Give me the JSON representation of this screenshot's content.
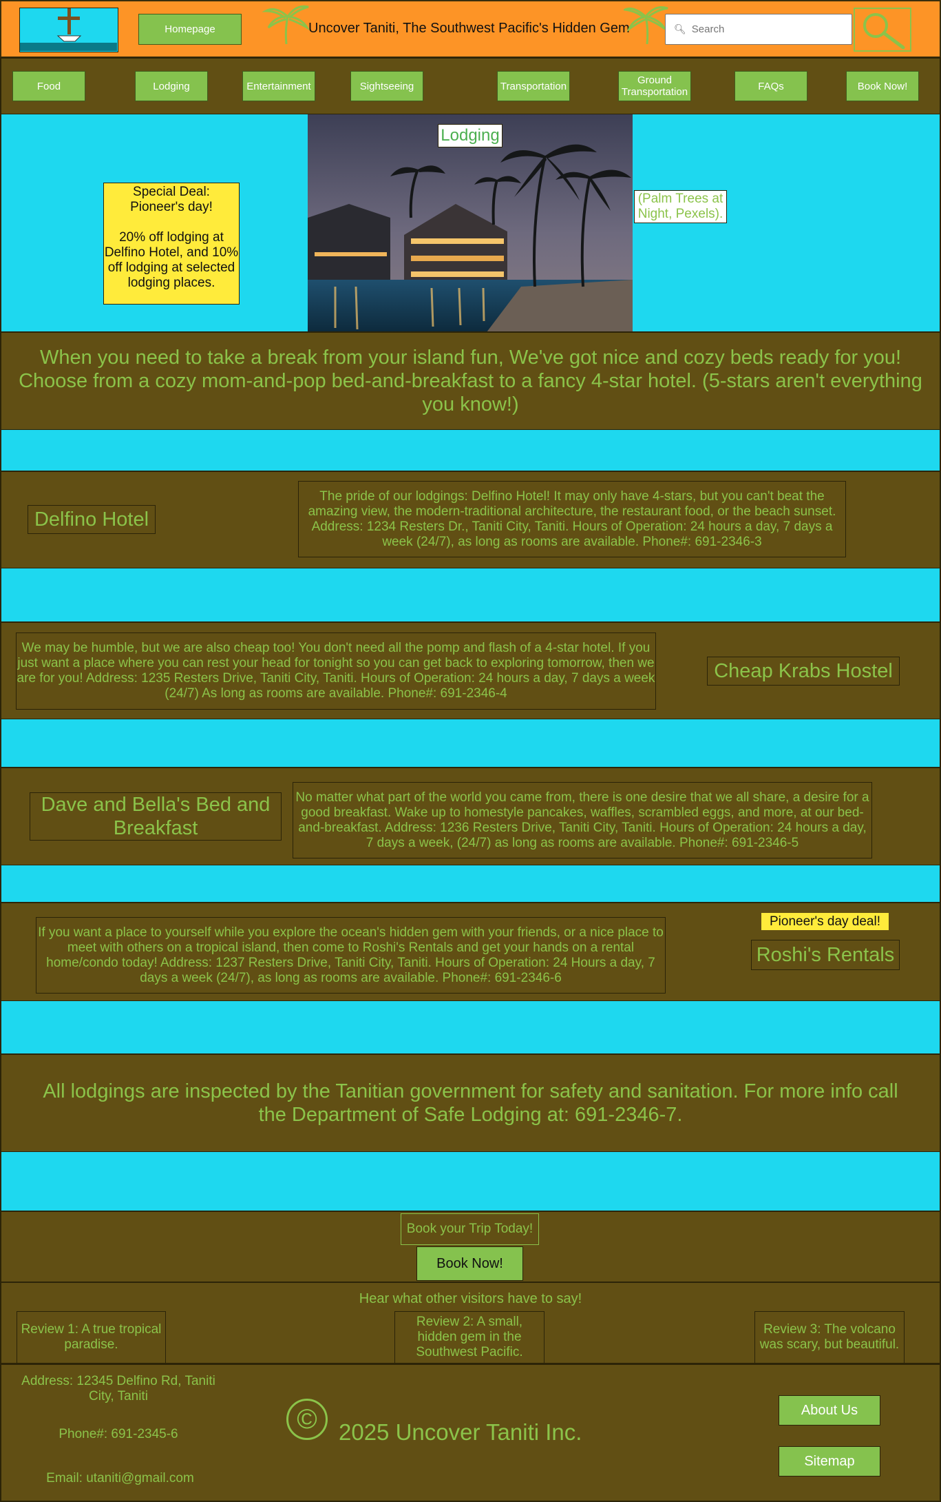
{
  "header": {
    "homepage_label": "Homepage",
    "site_title": "Uncover Taniti, The Southwest Pacific's Hidden Gem",
    "search_placeholder": "Search"
  },
  "nav": {
    "items": [
      {
        "label": "Food"
      },
      {
        "label": "Lodging"
      },
      {
        "label": "Entertainment"
      },
      {
        "label": "Sightseeing"
      },
      {
        "label": "Transportation"
      },
      {
        "label": "Ground Transportation"
      },
      {
        "label": "FAQs"
      },
      {
        "label": "Book Now!"
      }
    ]
  },
  "hero": {
    "deal_text": "Special Deal:\nPioneer's day!\n\n20% off lodging at Delfino Hotel, and 10% off lodging at selected lodging places.",
    "image_label": "Lodging",
    "image_credit": "(Palm Trees at Night, Pexels)."
  },
  "intro": {
    "text": "When you need to take a break from your island fun, We've got nice and cozy beds ready for you! Choose from a cozy mom-and-pop bed-and-breakfast to a fancy 4-star hotel. (5-stars aren't everything you know!)"
  },
  "lodgings": [
    {
      "name": "Delfino Hotel",
      "description": "The pride of our lodgings: Delfino Hotel! It may only have 4-stars, but you can't beat the amazing view, the modern-traditional architecture, the restaurant food, or the beach sunset. Address: 1234 Resters Dr., Taniti City, Taniti. Hours of Operation: 24 hours a day, 7 days a week (24/7), as long as rooms are available. Phone#: 691-2346-3"
    },
    {
      "name": "Cheap Krabs Hostel",
      "description": "We may be humble, but we are also cheap too! You don't need all the pomp and flash of a 4-star hotel. If you just want a place where you can rest your head for tonight so you can get back to exploring tomorrow, then we are for you! Address: 1235 Resters Drive, Taniti City, Taniti. Hours of Operation: 24 hours a day, 7 days a week (24/7) As long as rooms are available. Phone#: 691-2346-4"
    },
    {
      "name": "Dave and Bella's Bed and Breakfast",
      "description": "No matter what part of the world you came from, there is one desire that we all share, a desire for a good breakfast. Wake up to homestyle pancakes, waffles, scrambled eggs, and more, at our bed-and-breakfast. Address: 1236 Resters Drive, Taniti City, Taniti. Hours of Operation: 24 hours a day, 7 days a week, (24/7) as long as rooms are available. Phone#: 691-2346-5"
    },
    {
      "name": "Roshi's Rentals",
      "badge": "Pioneer's day deal!",
      "description": "If you want a place to yourself while you explore the ocean's hidden gem with your friends, or a nice place to meet with others on a tropical island, then come to Roshi's Rentals and get your hands on a rental home/condo today! Address: 1237 Resters Drive, Taniti City, Taniti. Hours of Operation: 24 Hours a day, 7 days a week (24/7), as long as rooms are available. Phone#: 691-2346-6"
    }
  ],
  "inspection": {
    "text": "All lodgings are inspected by the Tanitian government for safety and sanitation. For more info call the Department of Safe Lodging at: 691-2346-7."
  },
  "booking": {
    "heading": "Book your Trip Today!",
    "button_label": "Book Now!"
  },
  "reviews": {
    "heading": "Hear what other visitors have to say!",
    "items": [
      {
        "text": "Review 1: A true tropical paradise."
      },
      {
        "text": "Review 2: A small, hidden gem in the Southwest Pacific."
      },
      {
        "text": "Review 3: The volcano was scary, but beautiful."
      }
    ]
  },
  "footer": {
    "address": "Address: 12345 Delfino Rd, Taniti City, Taniti",
    "phone": "Phone#: 691-2345-6",
    "email": "Email: utaniti@gmail.com",
    "copyright_symbol": "©",
    "copyright": "2025 Uncover Taniti Inc.",
    "about_label": "About Us",
    "sitemap_label": "Sitemap"
  },
  "colors": {
    "header_orange": "#fd9426",
    "section_brown": "#614f14",
    "accent_cyan": "#1ed8ef",
    "text_green": "#8bc34a",
    "button_green": "#85c24e",
    "deal_yellow": "#ffeb3b"
  }
}
